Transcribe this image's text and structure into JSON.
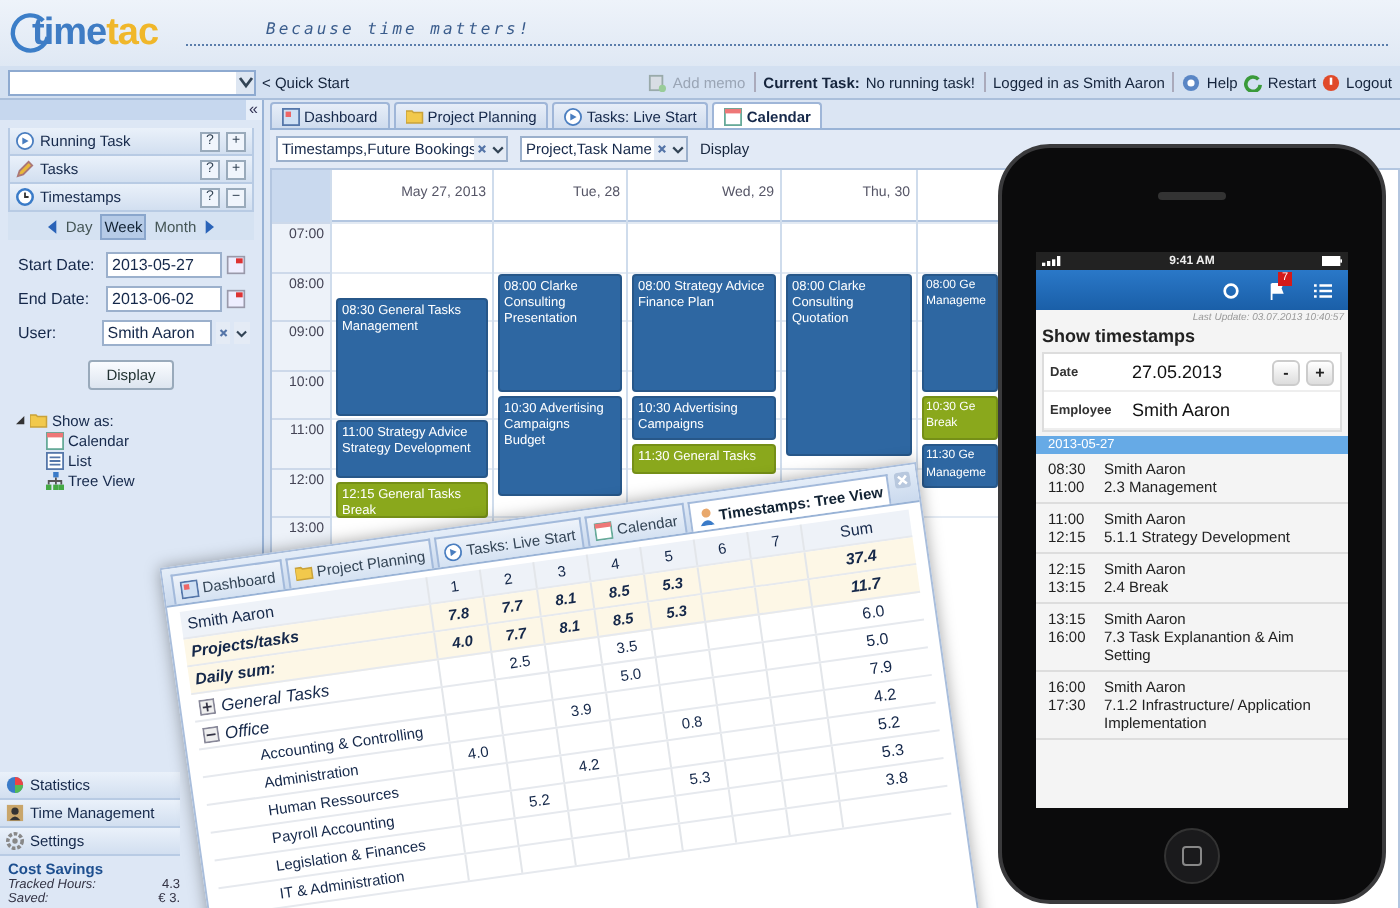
{
  "header": {
    "logo": [
      "time",
      "tac"
    ],
    "tagline": "Because time matters!"
  },
  "toolbar": {
    "quick_start": "< Quick Start",
    "add_memo": {
      "label": "Add memo",
      "disabled": true
    },
    "current_task_label": "Current Task:",
    "current_task": "No running task!",
    "logged_in": "Logged in as Smith Aaron",
    "links": [
      "Help",
      "Restart",
      "Logout"
    ]
  },
  "tabs": [
    {
      "label": "Dashboard",
      "selected": false
    },
    {
      "label": "Project Planning",
      "selected": false
    },
    {
      "label": "Tasks: Live Start",
      "selected": false
    },
    {
      "label": "Calendar",
      "selected": true
    }
  ],
  "sidebar": {
    "collapse": "«",
    "panels": [
      {
        "label": "Running Task",
        "help": "?",
        "toggle": "+"
      },
      {
        "label": "Tasks",
        "help": "?",
        "toggle": "+"
      },
      {
        "label": "Timestamps",
        "help": "?",
        "toggle": "−"
      }
    ],
    "ranges": [
      {
        "label": "Day",
        "selected": false
      },
      {
        "label": "Week",
        "selected": true
      },
      {
        "label": "Month",
        "selected": false
      }
    ],
    "form": [
      {
        "label": "Start Date:",
        "value": "2013-05-27",
        "kind": "date"
      },
      {
        "label": "End Date:",
        "value": "2013-06-02",
        "kind": "date"
      },
      {
        "label": "User:",
        "value": "Smith Aaron",
        "kind": "combo"
      }
    ],
    "display": "Display",
    "show_as": {
      "label": "Show as:",
      "expanded": true,
      "children": [
        {
          "label": "Calendar"
        },
        {
          "label": "List"
        },
        {
          "label": "Tree View"
        }
      ]
    },
    "bottom_panels": [
      "Statistics",
      "Time Management",
      "Settings"
    ],
    "cost_savings": {
      "title": "Cost Savings",
      "rows": [
        {
          "label": "Tracked Hours:",
          "value": "4.3"
        },
        {
          "label": "Saved:",
          "value": "€ 3."
        }
      ]
    }
  },
  "calendar": {
    "filters": [
      "Timestamps,Future Bookings",
      "Project,Task Name"
    ],
    "display": "Display",
    "times": [
      "07:00",
      "08:00",
      "09:00",
      "10:00",
      "11:00",
      "12:00",
      "13:00"
    ],
    "days": [
      {
        "label": "May 27, 2013",
        "events": [
          {
            "time": "08:30",
            "title": "General Tasks",
            "task": "Management",
            "color": "#2e67a2"
          },
          {
            "time": "11:00",
            "title": "Strategy Advice",
            "task": "Strategy Development",
            "color": "#2e67a2"
          },
          {
            "time": "12:15",
            "title": "General Tasks",
            "task": "Break",
            "color": "#8aa81c"
          }
        ]
      },
      {
        "label": "Tue, 28",
        "events": [
          {
            "time": "08:00",
            "title": "Clarke Consulting",
            "task": "Presentation",
            "color": "#2e67a2"
          },
          {
            "time": "10:30",
            "title": "Advertising Campaigns",
            "task": "Budget",
            "color": "#2e67a2"
          }
        ]
      },
      {
        "label": "Wed, 29",
        "events": [
          {
            "time": "08:00",
            "title": "Strategy Advice",
            "task": "Finance Plan",
            "color": "#2e67a2"
          },
          {
            "time": "10:30",
            "title": "Advertising Campaigns",
            "color": "#2e67a2"
          },
          {
            "time": "11:30",
            "title": "General Tasks",
            "color": "#8aa81c"
          }
        ]
      },
      {
        "label": "Thu, 30",
        "events": [
          {
            "time": "08:00",
            "title": "Clarke Consulting",
            "task": "Quotation",
            "color": "#2e67a2"
          }
        ]
      },
      {
        "events": [
          {
            "time": "08:00",
            "title": "Ge",
            "task": "Manageme",
            "color": "#2e67a2"
          },
          {
            "time": "10:30",
            "title": "Ge",
            "task": "Break",
            "color": "#8aa81c"
          },
          {
            "time": "11:30",
            "title": "Ge",
            "task": "Manageme",
            "color": "#2e67a2"
          }
        ]
      }
    ]
  },
  "tree_view": {
    "tabs": [
      {
        "label": "Dashboard",
        "selected": false
      },
      {
        "label": "Project Planning",
        "selected": false
      },
      {
        "label": "Tasks: Live Start",
        "selected": false
      },
      {
        "label": "Calendar",
        "selected": false
      },
      {
        "label": "Timestamps: Tree View",
        "selected": true
      }
    ],
    "employee": "Smith Aaron",
    "columns": [
      "1",
      "2",
      "3",
      "4",
      "5",
      "6",
      "7"
    ],
    "sum_label": "Sum",
    "totals": [
      {
        "label": "Projects/tasks",
        "cells": [
          "7.8",
          "7.7",
          "8.1",
          "8.5",
          "5.3",
          null,
          null
        ],
        "sum": "37.4"
      },
      {
        "label": "Daily sum:",
        "cells": [
          "4.0",
          "7.7",
          "8.1",
          "8.5",
          "5.3",
          null,
          null
        ],
        "sum": "11.7"
      }
    ],
    "tree": [
      {
        "label": "General Tasks",
        "expanded": false,
        "cells": [
          null,
          "2.5",
          null,
          "3.5",
          null,
          null,
          null
        ],
        "sum": "6.0"
      },
      {
        "label": "Office",
        "expanded": true,
        "cells": [
          null,
          null,
          null,
          "5.0",
          null,
          null,
          null
        ],
        "sum": "5.0",
        "children": [
          {
            "label": "Accounting & Controlling",
            "cells": [
              null,
              null,
              "3.9",
              null,
              null,
              null,
              null
            ],
            "sum": "7.9"
          },
          {
            "label": "Administration",
            "cells": [
              "4.0",
              null,
              null,
              null,
              "0.8",
              null,
              null
            ],
            "sum": "4.2"
          },
          {
            "label": "Human Ressources",
            "cells": [
              null,
              null,
              "4.2",
              null,
              null,
              null,
              null
            ],
            "sum": "5.2"
          },
          {
            "label": "Payroll Accounting",
            "cells": [
              null,
              "5.2",
              null,
              null,
              "5.3",
              null,
              null
            ],
            "sum": "5.3"
          },
          {
            "label": "Legislation & Finances",
            "cells": [
              null,
              null,
              null,
              null,
              null,
              null,
              null
            ],
            "sum": "3.8"
          },
          {
            "label": "IT & Administration",
            "cells": [
              null,
              null,
              null,
              null,
              null,
              null,
              null
            ]
          }
        ]
      }
    ]
  },
  "phone": {
    "time": "9:41 AM",
    "badge": "7",
    "last_update": "Last Update: 03.07.2013 10:40:57",
    "title": "Show timestamps",
    "date_label": "Date",
    "date": "27.05.2013",
    "steppers": [
      "-",
      "+"
    ],
    "employee_label": "Employee",
    "employee": "Smith Aaron",
    "group": "2013-05-27",
    "entries": [
      {
        "start": "08:30",
        "end": "11:00",
        "name": "Smith Aaron",
        "task": "2.3 Management"
      },
      {
        "start": "11:00",
        "end": "12:15",
        "name": "Smith Aaron",
        "task": "5.1.1 Strategy Development"
      },
      {
        "start": "12:15",
        "end": "13:15",
        "name": "Smith Aaron",
        "task": "2.4 Break"
      },
      {
        "start": "13:15",
        "end": "16:00",
        "name": "Smith Aaron",
        "task": "7.3 Task Explanantion & Aim Setting"
      },
      {
        "start": "16:00",
        "end": "17:30",
        "name": "Smith Aaron",
        "task": "7.1.2 Infrastructure/ Application Implementation"
      }
    ]
  }
}
